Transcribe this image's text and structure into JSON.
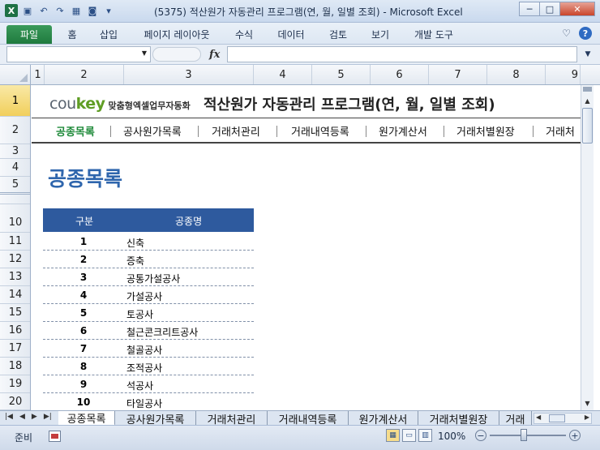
{
  "window": {
    "title": "(5375) 적산원가 자동관리 프로그램(연, 월, 일별 조회)  -  Microsoft Excel",
    "minimize": "─",
    "maximize": "□",
    "close": "✕"
  },
  "ribbon": {
    "tabs": [
      "파일",
      "홈",
      "삽입",
      "페이지 레이아웃",
      "수식",
      "데이터",
      "검토",
      "보기",
      "개발 도구"
    ]
  },
  "formula_bar": {
    "name_box": "",
    "formula": "",
    "fx": "fx"
  },
  "columns": [
    "1",
    "2",
    "3",
    "4",
    "5",
    "6",
    "7",
    "8",
    "9"
  ],
  "rows": [
    "1",
    "2",
    "3",
    "4",
    "5",
    "10",
    "11",
    "12",
    "13",
    "14",
    "15",
    "16",
    "17",
    "18",
    "19",
    "20"
  ],
  "header": {
    "logo_cou": "cou",
    "logo_key": "key",
    "logo_sub": "맞춤형엑셀업무자동화",
    "program_title": "적산원가 자동관리 프로그램(연, 월, 일별 조회)"
  },
  "nav": [
    "공종목록",
    "공사원가목록",
    "거래처관리",
    "거래내역등록",
    "원가계산서",
    "거래처별원장",
    "거래처"
  ],
  "page_heading": "공종목록",
  "table": {
    "col_no": "구분",
    "col_name": "공종명",
    "rows": [
      {
        "no": "1",
        "name": "신축"
      },
      {
        "no": "2",
        "name": "증축"
      },
      {
        "no": "3",
        "name": "공통가설공사"
      },
      {
        "no": "4",
        "name": "가설공사"
      },
      {
        "no": "5",
        "name": "토공사"
      },
      {
        "no": "6",
        "name": "철근콘크리트공사"
      },
      {
        "no": "7",
        "name": "철골공사"
      },
      {
        "no": "8",
        "name": "조적공사"
      },
      {
        "no": "9",
        "name": "석공사"
      },
      {
        "no": "10",
        "name": "타일공사"
      }
    ]
  },
  "sheet_tabs": [
    "공종목록",
    "공사원가목록",
    "거래처관리",
    "거래내역등록",
    "원가계산서",
    "거래처별원장",
    "거래"
  ],
  "status": {
    "ready": "준비",
    "zoom": "100%"
  }
}
